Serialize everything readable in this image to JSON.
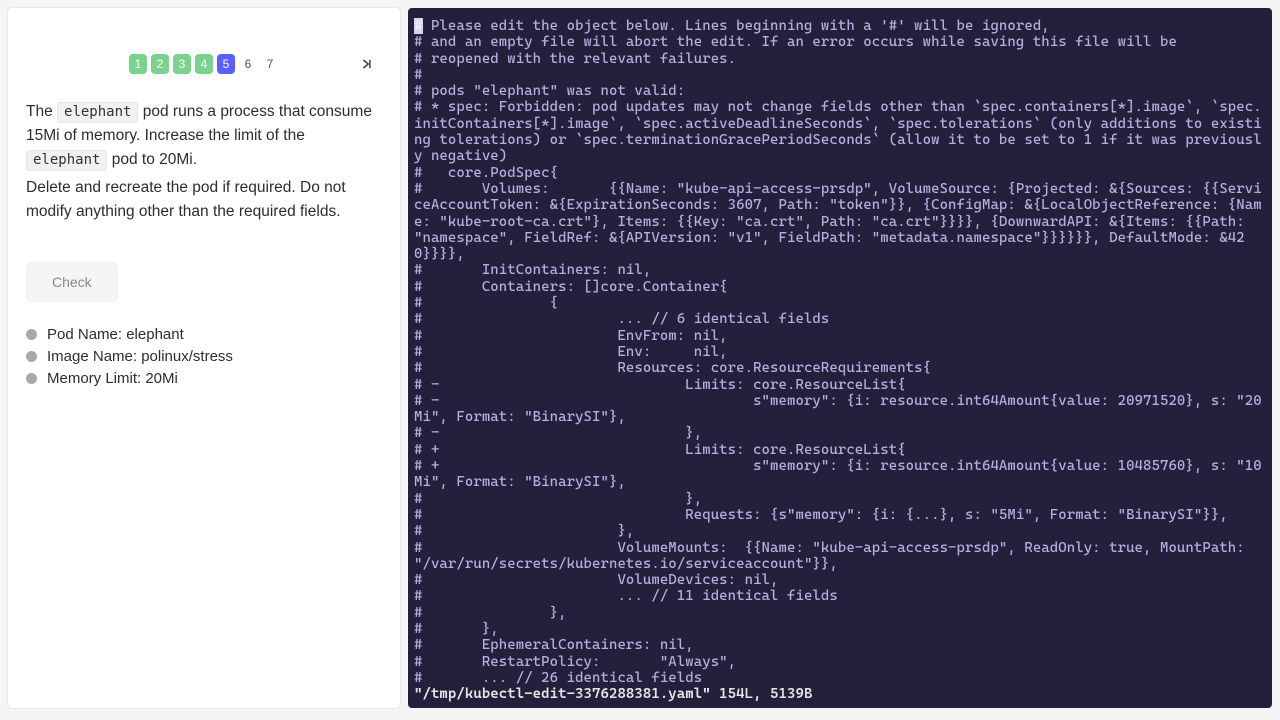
{
  "pagination": {
    "pages": [
      {
        "n": "1",
        "state": "done"
      },
      {
        "n": "2",
        "state": "done"
      },
      {
        "n": "3",
        "state": "done"
      },
      {
        "n": "4",
        "state": "done"
      },
      {
        "n": "5",
        "state": "current"
      },
      {
        "n": "6",
        "state": ""
      },
      {
        "n": "7",
        "state": ""
      }
    ]
  },
  "instructions": {
    "p1a": "The ",
    "code1": "elephant",
    "p1b": " pod runs a process that consume 15Mi of memory. Increase the limit of the ",
    "code2": "elephant",
    "p1c": " pod to 20Mi.",
    "p2": "Delete and recreate the pod if required. Do not modify anything other than the required fields."
  },
  "check_label": "Check",
  "criteria": [
    "Pod Name: elephant",
    "Image Name: polinux/stress",
    "Memory Limit: 20Mi"
  ],
  "terminal_lines": [
    "# Please edit the object below. Lines beginning with a '#' will be ignored,",
    "# and an empty file will abort the edit. If an error occurs while saving this file will be",
    "# reopened with the relevant failures.",
    "#",
    "# pods \"elephant\" was not valid:",
    "# * spec: Forbidden: pod updates may not change fields other than `spec.containers[*].image`, `spec.initContainers[*].image`, `spec.activeDeadlineSeconds`, `spec.tolerations` (only additions to existing tolerations) or `spec.terminationGracePeriodSeconds` (allow it to be set to 1 if it was previously negative)",
    "#   core.PodSpec{",
    "#       Volumes:       {{Name: \"kube-api-access-prsdp\", VolumeSource: {Projected: &{Sources: {{ServiceAccountToken: &{ExpirationSeconds: 3607, Path: \"token\"}}, {ConfigMap: &{LocalObjectReference: {Name: \"kube-root-ca.crt\"}, Items: {{Key: \"ca.crt\", Path: \"ca.crt\"}}}}, {DownwardAPI: &{Items: {{Path: \"namespace\", FieldRef: &{APIVersion: \"v1\", FieldPath: \"metadata.namespace\"}}}}}}, DefaultMode: &420}}}},",
    "#       InitContainers: nil,",
    "#       Containers: []core.Container{",
    "#               {",
    "#                       ... // 6 identical fields",
    "#                       EnvFrom: nil,",
    "#                       Env:     nil,",
    "#                       Resources: core.ResourceRequirements{",
    "# -                             Limits: core.ResourceList{",
    "# -                                     s\"memory\": {i: resource.int64Amount{value: 20971520}, s: \"20Mi\", Format: \"BinarySI\"},",
    "# -                             },",
    "# +                             Limits: core.ResourceList{",
    "# +                                     s\"memory\": {i: resource.int64Amount{value: 10485760}, s: \"10Mi\", Format: \"BinarySI\"},",
    "#                               },",
    "#                               Requests: {s\"memory\": {i: {...}, s: \"5Mi\", Format: \"BinarySI\"}},",
    "#                       },",
    "#                       VolumeMounts:  {{Name: \"kube-api-access-prsdp\", ReadOnly: true, MountPath: \"/var/run/secrets/kubernetes.io/serviceaccount\"}},",
    "#                       VolumeDevices: nil,",
    "#                       ... // 11 identical fields",
    "#               },",
    "#       },",
    "#       EphemeralContainers: nil,",
    "#       RestartPolicy:       \"Always\",",
    "#       ... // 26 identical fields"
  ],
  "terminal_status": "\"/tmp/kubectl-edit-3376288381.yaml\" 154L, 5139B"
}
